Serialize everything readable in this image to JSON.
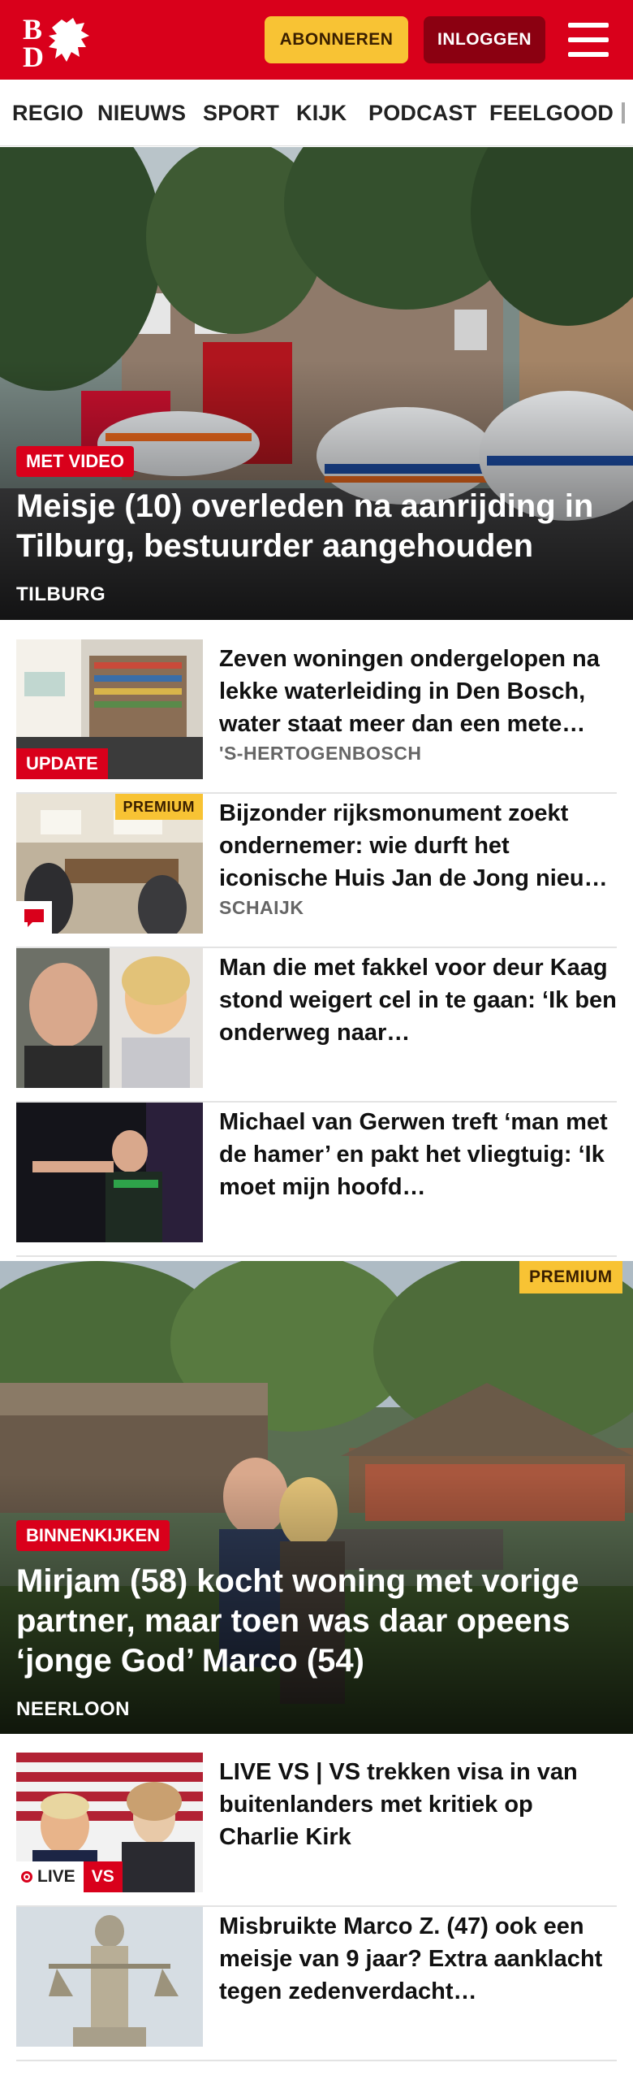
{
  "header": {
    "logo_text": "BD",
    "subscribe_label": "ABONNEREN",
    "login_label": "INLOGGEN",
    "menu_icon": "hamburger-menu-icon",
    "brand_color": "#d9001b"
  },
  "nav": {
    "items": [
      "REGIO",
      "NIEUWS",
      "SPORT",
      "KIJK",
      "PODCAST",
      "FEELGOOD"
    ]
  },
  "hero1": {
    "tag": "MET VIDEO",
    "title": "Meisje (10) overleden na aanrijding in Tilburg, bestuurder aangehouden",
    "place": "TILBURG"
  },
  "articles1": [
    {
      "title": "Zeven woningen ondergelopen na lekke waterleiding in Den Bosch, water staat meer dan een mete…",
      "place": "'S-HERTOGENBOSCH",
      "tag": "UPDATE"
    },
    {
      "title": "Bijzonder rijksmonument zoekt ondernemer: wie durft het iconische Huis Jan de Jong nieu…",
      "place": "SCHAIJK",
      "premium": "PREMIUM",
      "icon": "comment-icon"
    },
    {
      "title": "Man die met fakkel voor deur Kaag stond weigert cel in te gaan: ‘Ik ben onderweg naar…"
    },
    {
      "title": "Michael van Gerwen treft ‘man met de hamer’ en pakt het vliegtuig: ‘Ik moet mijn hoofd…"
    }
  ],
  "hero2": {
    "premium": "PREMIUM",
    "tag": "BINNENKIJKEN",
    "title": "Mirjam (58) kocht woning met vorige partner, maar toen was daar opeens ‘jonge God’ Marco (54)",
    "place": "NEERLOON"
  },
  "articles2": [
    {
      "title": "LIVE VS | VS trekken visa in van buitenlanders met kritiek op Charlie Kirk",
      "live": "LIVE",
      "live_topic": "VS"
    },
    {
      "title": "Misbruikte Marco Z. (47) ook een meisje van 9 jaar? Extra aanklacht tegen zedenverdacht…"
    }
  ]
}
